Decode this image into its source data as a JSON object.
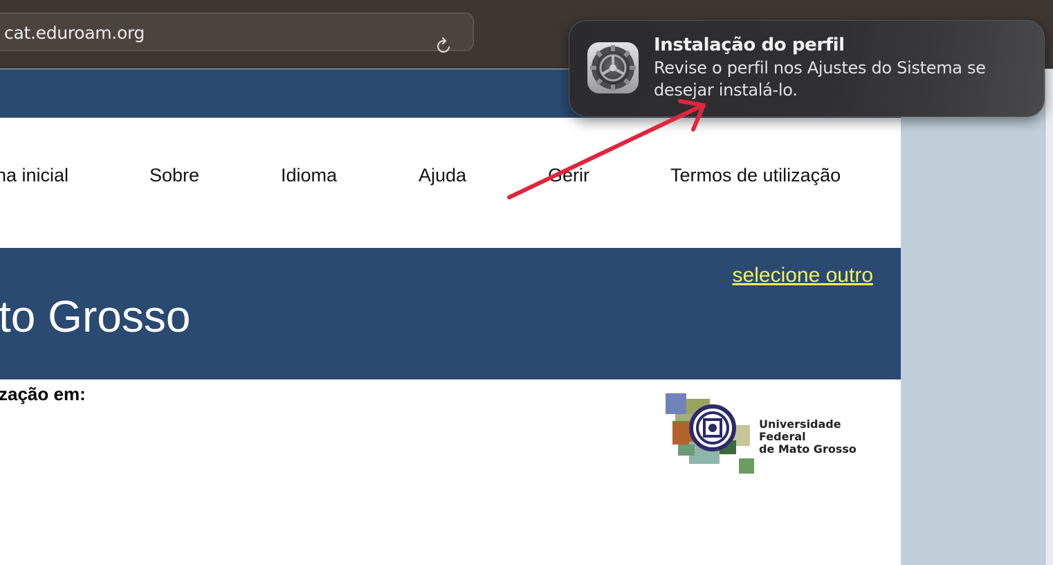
{
  "browser": {
    "url": "cat.eduroam.org"
  },
  "nav": {
    "items": [
      "na inicial",
      "Sobre",
      "Idioma",
      "Ajuda",
      "Gerir",
      "Termos de utilização"
    ]
  },
  "institution": {
    "name": "to Grosso",
    "select_other": "selecione outro",
    "subheading": "zação em:",
    "logo_text_line1": "Universidade Federal",
    "logo_text_line2": "de Mato Grosso"
  },
  "notification": {
    "title": "Instalação do perfil",
    "body": "Revise o perfil nos Ajustes do Sistema se desejar instalá-lo.",
    "icon": "system-settings-gear-icon"
  },
  "colors": {
    "brand_blue": "#2a4a72",
    "link_yellow": "#f3f35a",
    "annotation_red": "#e0253d"
  }
}
